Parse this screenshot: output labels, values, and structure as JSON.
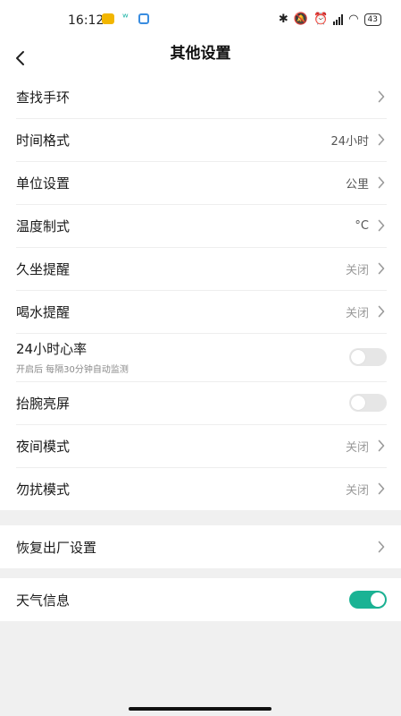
{
  "status_bar": {
    "time": "16:12",
    "battery": "43"
  },
  "header": {
    "title": "其他设置"
  },
  "group1": [
    {
      "label": "查找手环",
      "value": "",
      "type": "nav"
    },
    {
      "label": "时间格式",
      "value": "24小时",
      "type": "nav"
    },
    {
      "label": "单位设置",
      "value": "公里",
      "type": "nav"
    },
    {
      "label": "温度制式",
      "value": "°C",
      "type": "nav"
    },
    {
      "label": "久坐提醒",
      "value": "关闭",
      "type": "nav"
    },
    {
      "label": "喝水提醒",
      "value": "关闭",
      "type": "nav"
    },
    {
      "label": "24小时心率",
      "sub": "开启后 每隔30分钟自动监测",
      "type": "toggle",
      "on": false
    },
    {
      "label": "抬腕亮屏",
      "type": "toggle",
      "on": false
    },
    {
      "label": "夜间模式",
      "value": "关闭",
      "type": "nav"
    },
    {
      "label": "勿扰模式",
      "value": "关闭",
      "type": "nav"
    }
  ],
  "group2": [
    {
      "label": "恢复出厂设置",
      "type": "nav"
    }
  ],
  "group3": [
    {
      "label": "天气信息",
      "type": "toggle",
      "on": true
    }
  ],
  "colors": {
    "accent": "#1ab394",
    "background": "#f0f0f0"
  }
}
